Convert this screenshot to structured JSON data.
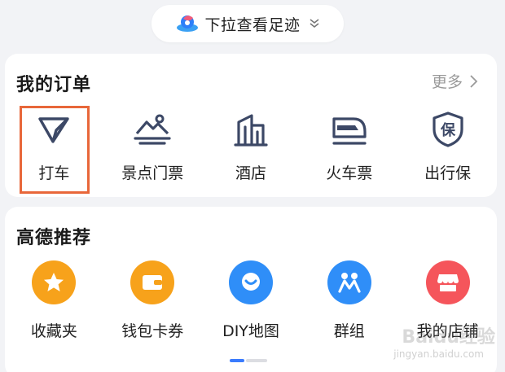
{
  "pulldown": {
    "text": "下拉查看足迹"
  },
  "orders": {
    "title": "我的订单",
    "more": "更多",
    "items": [
      {
        "label": "打车",
        "icon": "taxi-icon"
      },
      {
        "label": "景点门票",
        "icon": "scenic-ticket-icon"
      },
      {
        "label": "酒店",
        "icon": "hotel-icon"
      },
      {
        "label": "火车票",
        "icon": "train-icon"
      },
      {
        "label": "出行保",
        "icon": "insurance-icon"
      }
    ]
  },
  "recommend": {
    "title": "高德推荐",
    "items": [
      {
        "label": "收藏夹",
        "icon": "star-icon",
        "color": "#f7a21b"
      },
      {
        "label": "钱包卡券",
        "icon": "wallet-icon",
        "color": "#f7a21b"
      },
      {
        "label": "DIY地图",
        "icon": "map-pin-icon",
        "color": "#2f8ef8"
      },
      {
        "label": "群组",
        "icon": "group-icon",
        "color": "#2f8ef8"
      },
      {
        "label": "我的店铺",
        "icon": "shop-icon",
        "color": "#f5555b"
      }
    ]
  },
  "watermark": {
    "main": "Baidu经验",
    "url": "jingyan.baidu.com"
  },
  "colors": {
    "highlight": "#e8673a",
    "icon_stroke": "#3c4866",
    "pager_active": "#3a7bfd"
  }
}
